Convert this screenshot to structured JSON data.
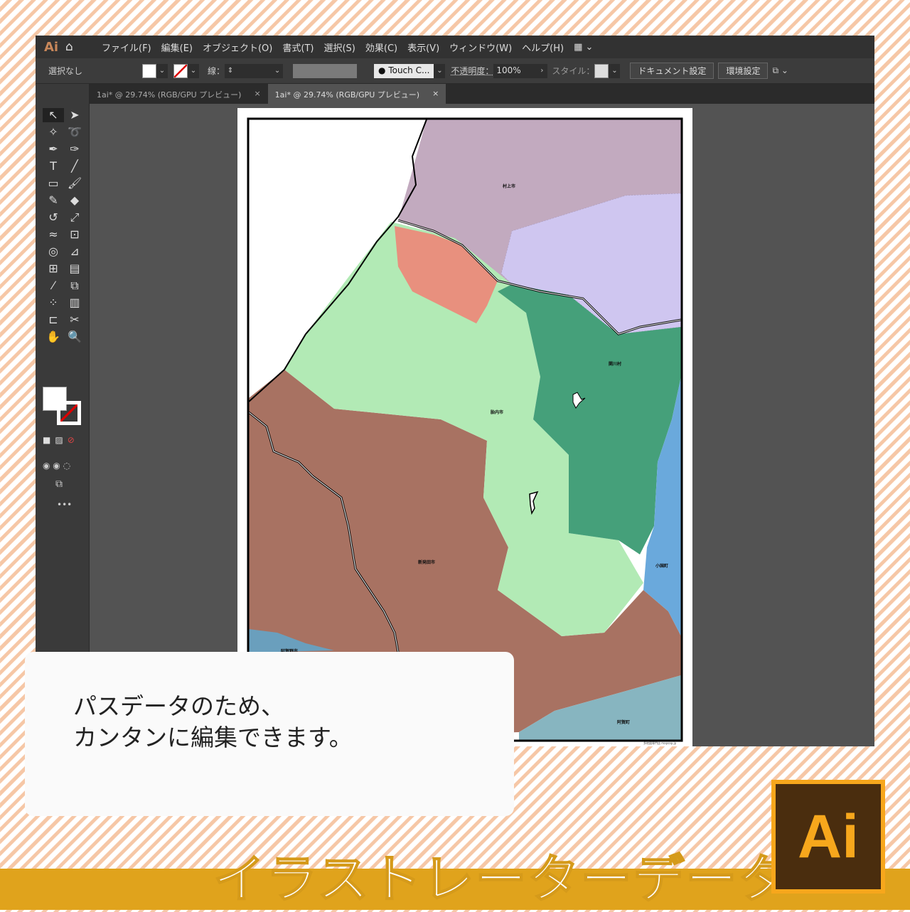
{
  "app": {
    "logo": "Ai",
    "menus": [
      "ファイル(F)",
      "編集(E)",
      "オブジェクト(O)",
      "書式(T)",
      "選択(S)",
      "効果(C)",
      "表示(V)",
      "ウィンドウ(W)",
      "ヘルプ(H)"
    ]
  },
  "control": {
    "selection": "選択なし",
    "stroke_label": "線：",
    "brush": "Touch C...",
    "opacity_label": "不透明度：",
    "opacity": "100%",
    "style_label": "スタイル：",
    "doc_settings": "ドキュメント設定",
    "preferences": "環境設定"
  },
  "tabs": [
    {
      "label": "1ai* @ 29.74% (RGB/GPU プレビュー)",
      "close": "×"
    },
    {
      "label": "1ai* @ 29.74% (RGB/GPU プレビュー)",
      "close": "×"
    }
  ],
  "map": {
    "labels": [
      "村上市",
      "関川村",
      "胎内市",
      "新発田市",
      "小国町",
      "阿賀町",
      "阿賀野市"
    ],
    "credit": "多地図専門店 mapsap.jp"
  },
  "caption": {
    "line1": "パスデータのため、",
    "line2": "カンタンに編集できます。"
  },
  "banner": {
    "title": "イラストレーターデータ",
    "logo": "Ai"
  },
  "colors": {
    "murakami": "#c2aabf",
    "lavender": "#cfc6f0",
    "tainai": "#b2eab5",
    "salmon": "#e8907e",
    "sekikawa": "#45a07a",
    "oguni": "#6aa9dc",
    "shibata": "#a87262",
    "aga": "#87b5c0",
    "aganoshi": "#6a9fbd",
    "band": "#e0a31c"
  }
}
